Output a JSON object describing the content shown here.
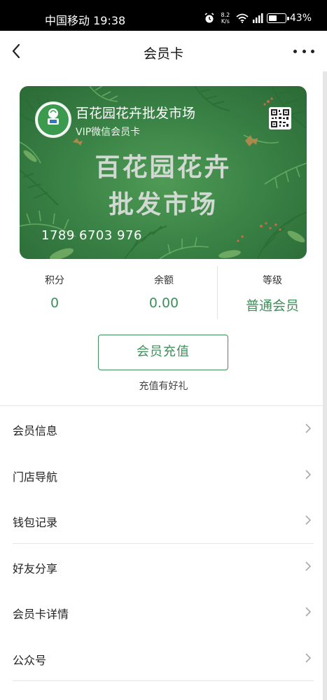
{
  "status_bar": {
    "carrier_time": "中国移动 19:38",
    "net_speed_value": "8.2",
    "net_speed_unit": "K/s",
    "battery": "43%",
    "icons": [
      "alarm-icon",
      "wifi-icon",
      "signal-icon",
      "battery-icon"
    ]
  },
  "nav": {
    "title": "会员卡",
    "back_icon": "back-chevron-icon",
    "more_icon": "more-dots-icon"
  },
  "card": {
    "store_name": "百花园花卉批发市场",
    "vip_label": "VIP微信会员卡",
    "big_line1": "百花园花卉",
    "big_line2": "批发市场",
    "card_number": "1789 6703 976",
    "logo_text": "百花园花卉",
    "qr_icon": "qr-code-icon"
  },
  "stats": [
    {
      "label": "积分",
      "value": "0"
    },
    {
      "label": "余额",
      "value": "0.00"
    },
    {
      "label": "等级",
      "value": "普通会员"
    }
  ],
  "recharge": {
    "button_label": "会员充值",
    "tip": "充值有好礼"
  },
  "menu": [
    {
      "label": "会员信息"
    },
    {
      "label": "门店导航"
    },
    {
      "label": "钱包记录"
    },
    {
      "label": "好友分享"
    },
    {
      "label": "会员卡详情"
    },
    {
      "label": "公众号"
    }
  ],
  "colors": {
    "accent": "#3f8f5a",
    "card_green": "#3b8447",
    "status_bar": "#000000"
  }
}
